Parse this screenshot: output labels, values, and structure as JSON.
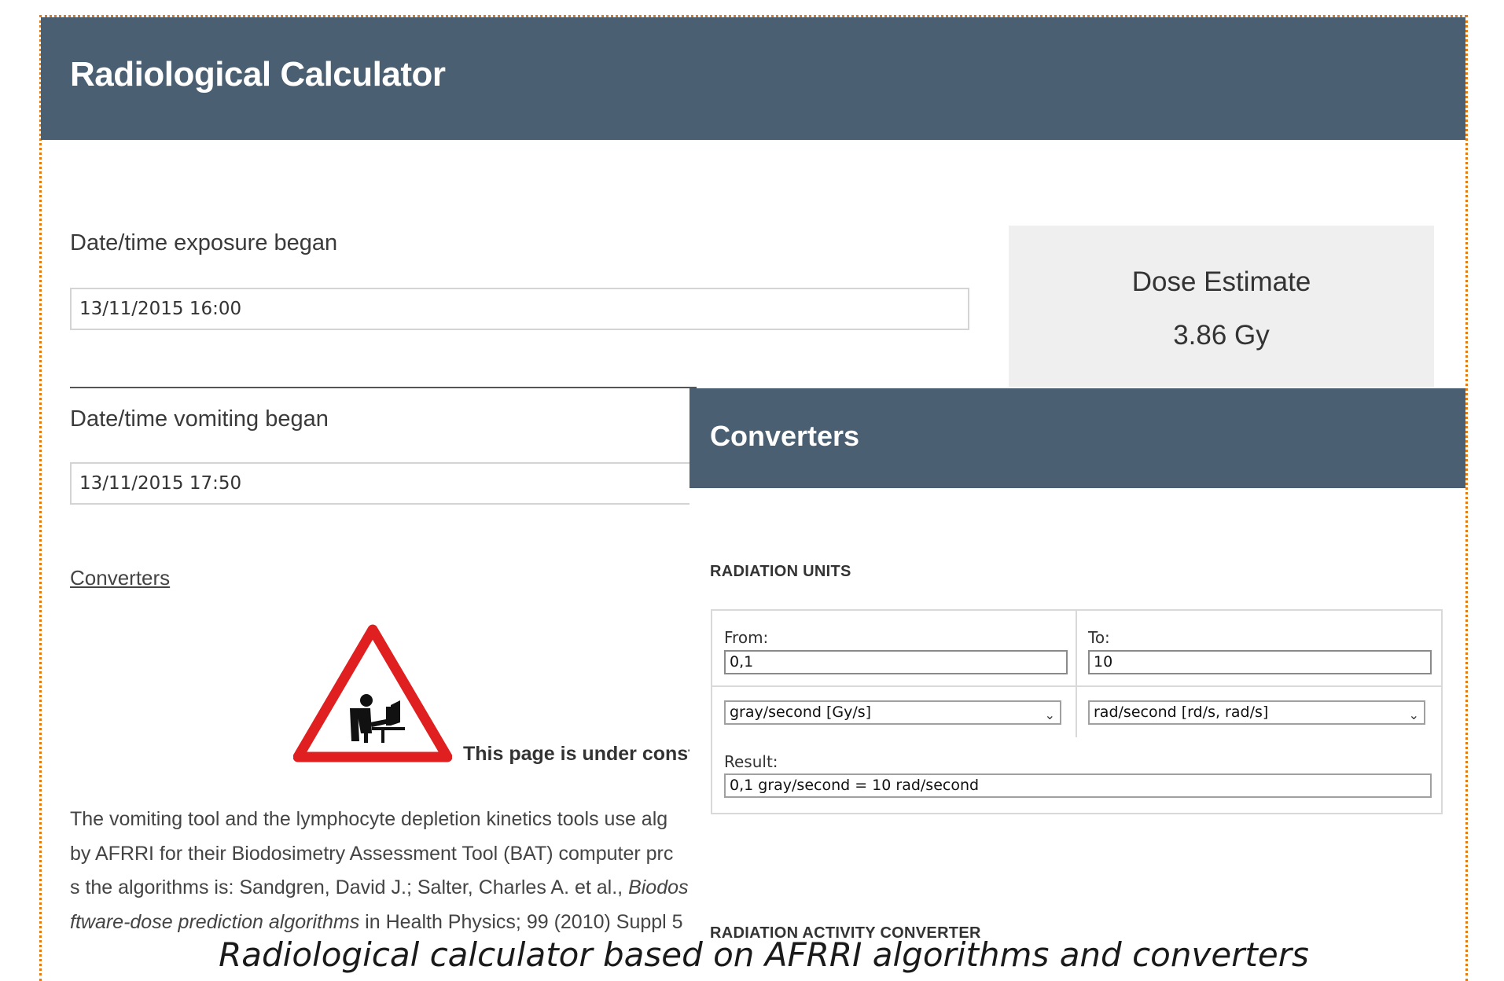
{
  "calculator": {
    "title": "Radiological Calculator",
    "exposure_label": "Date/time exposure began",
    "exposure_value": "13/11/2015 16:00",
    "vomiting_label": "Date/time vomiting began",
    "vomiting_value": "13/11/2015 17:50",
    "dose": {
      "title": "Dose Estimate",
      "value": "3.86 Gy"
    },
    "converters_link": "Converters",
    "construction_text": "This page is under constr",
    "paragraph": {
      "line1": "The vomiting tool and the lymphocyte depletion kinetics tools use alg",
      "line2": "by AFRRI for their Biodosimetry Assessment Tool (BAT) computer prc",
      "line3_prefix": "s the algorithms is: Sandgren, David J.; Salter, Charles A. et al., ",
      "line3_italic": "Biodos",
      "line4_italic": "ftware-dose prediction algorithms",
      "line4_suffix": " in Health Physics; 99 (2010) Suppl 5"
    }
  },
  "converters": {
    "title": "Converters",
    "radiation_units_heading": "RADIATION UNITS",
    "from_label": "From:",
    "from_value": "0,1",
    "to_label": "To:",
    "to_value": "10",
    "from_unit": "gray/second [Gy/s]",
    "to_unit": "rad/second [rd/s, rad/s]",
    "result_label": "Result:",
    "result_value": "0,1 gray/second = 10 rad/second",
    "activity_heading": "RADIATION ACTIVITY CONVERTER"
  },
  "caption": "Radiological calculator based on AFRRI algorithms and converters",
  "colors": {
    "header": "#4a5f72",
    "frame": "#e07b1a",
    "warning_red": "#e02020"
  },
  "icons": {
    "warning": "construction-warning-sign-icon",
    "dropdown": "chevron-down-icon"
  }
}
